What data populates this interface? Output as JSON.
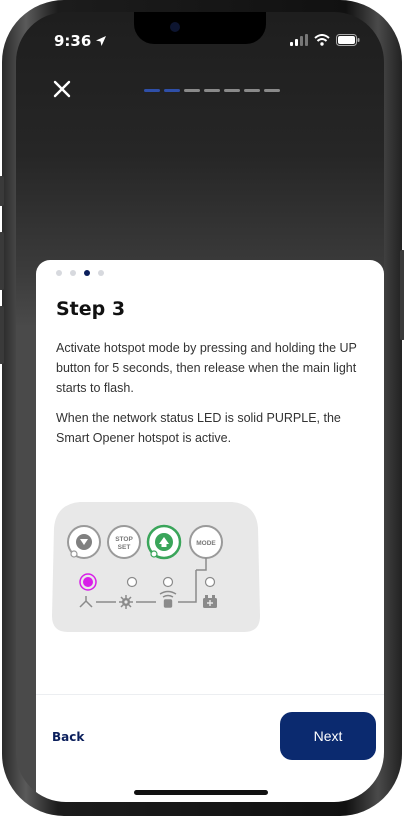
{
  "status_bar": {
    "time": "9:36"
  },
  "progress": {
    "total_segments": 7,
    "completed_segments": 2
  },
  "carousel": {
    "total_dots": 4,
    "active_dot": 3
  },
  "step": {
    "title": "Step 3",
    "instruction": "Activate hotspot mode by pressing and holding the UP button for 5 seconds, then release when the main light starts to flash.",
    "note": "When the network status LED is solid PURPLE, the Smart Opener hotspot is active."
  },
  "panel_labels": {
    "stop_line1": "STOP",
    "stop_line2": "SET",
    "mode": "MODE"
  },
  "colors": {
    "accent_green": "#3aa55a",
    "led_purple": "#d81ee8",
    "brand_navy": "#0b2a6f"
  },
  "footer": {
    "back_label": "Back",
    "next_label": "Next"
  }
}
